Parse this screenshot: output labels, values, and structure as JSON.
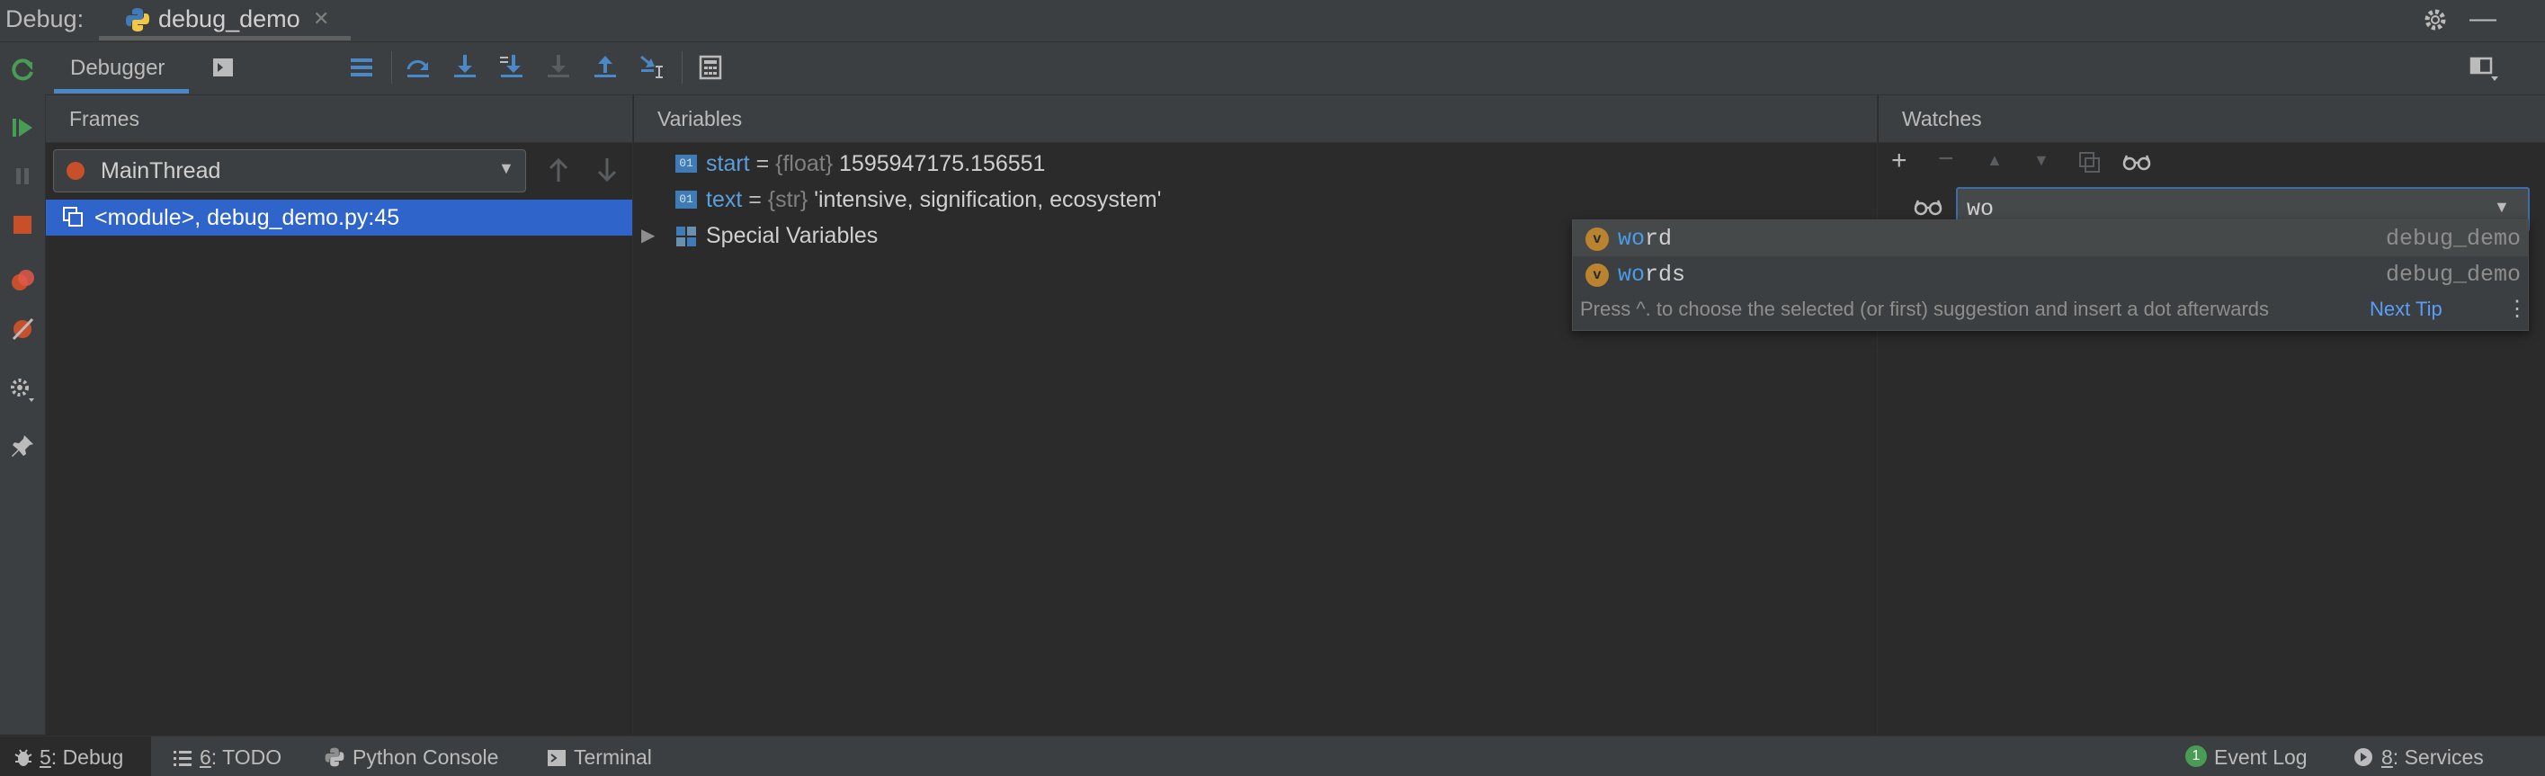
{
  "title_bar": {
    "label": "Debug:",
    "tab_name": "debug_demo"
  },
  "toolbar": {
    "debugger_tab": "Debugger",
    "console_tab": "Console"
  },
  "frames": {
    "header": "Frames",
    "thread": "MainThread",
    "selected_frame": "<module>, debug_demo.py:45"
  },
  "variables": {
    "header": "Variables",
    "rows": [
      {
        "name": "start",
        "eq": " = ",
        "type": "{float}",
        "value": "1595947175.156551"
      },
      {
        "name": "text",
        "eq": " = ",
        "type": "{str}",
        "value": "'intensive, signification, ecosystem'"
      },
      {
        "name": "Special Variables"
      }
    ]
  },
  "watches": {
    "header": "Watches",
    "input_value": "wo",
    "suggestions": [
      {
        "match": "wo",
        "rest": "rd",
        "module": "debug_demo",
        "badge": "v"
      },
      {
        "match": "wo",
        "rest": "rds",
        "module": "debug_demo",
        "badge": "v"
      }
    ],
    "tip": "Press ^. to choose the selected (or first) suggestion and insert a dot afterwards",
    "next_tip": "Next Tip"
  },
  "statusbar": {
    "debug": {
      "num": "5",
      "label": ": Debug"
    },
    "todo": {
      "num": "6",
      "label": ": TODO"
    },
    "python_console": "Python Console",
    "terminal": "Terminal",
    "event_log_count": "1",
    "event_log": "Event Log",
    "services": {
      "num": "8",
      "label": ": Services"
    }
  },
  "colors": {
    "accent": "#2f65ca",
    "stop": "#c7502b",
    "run": "#499c54"
  }
}
